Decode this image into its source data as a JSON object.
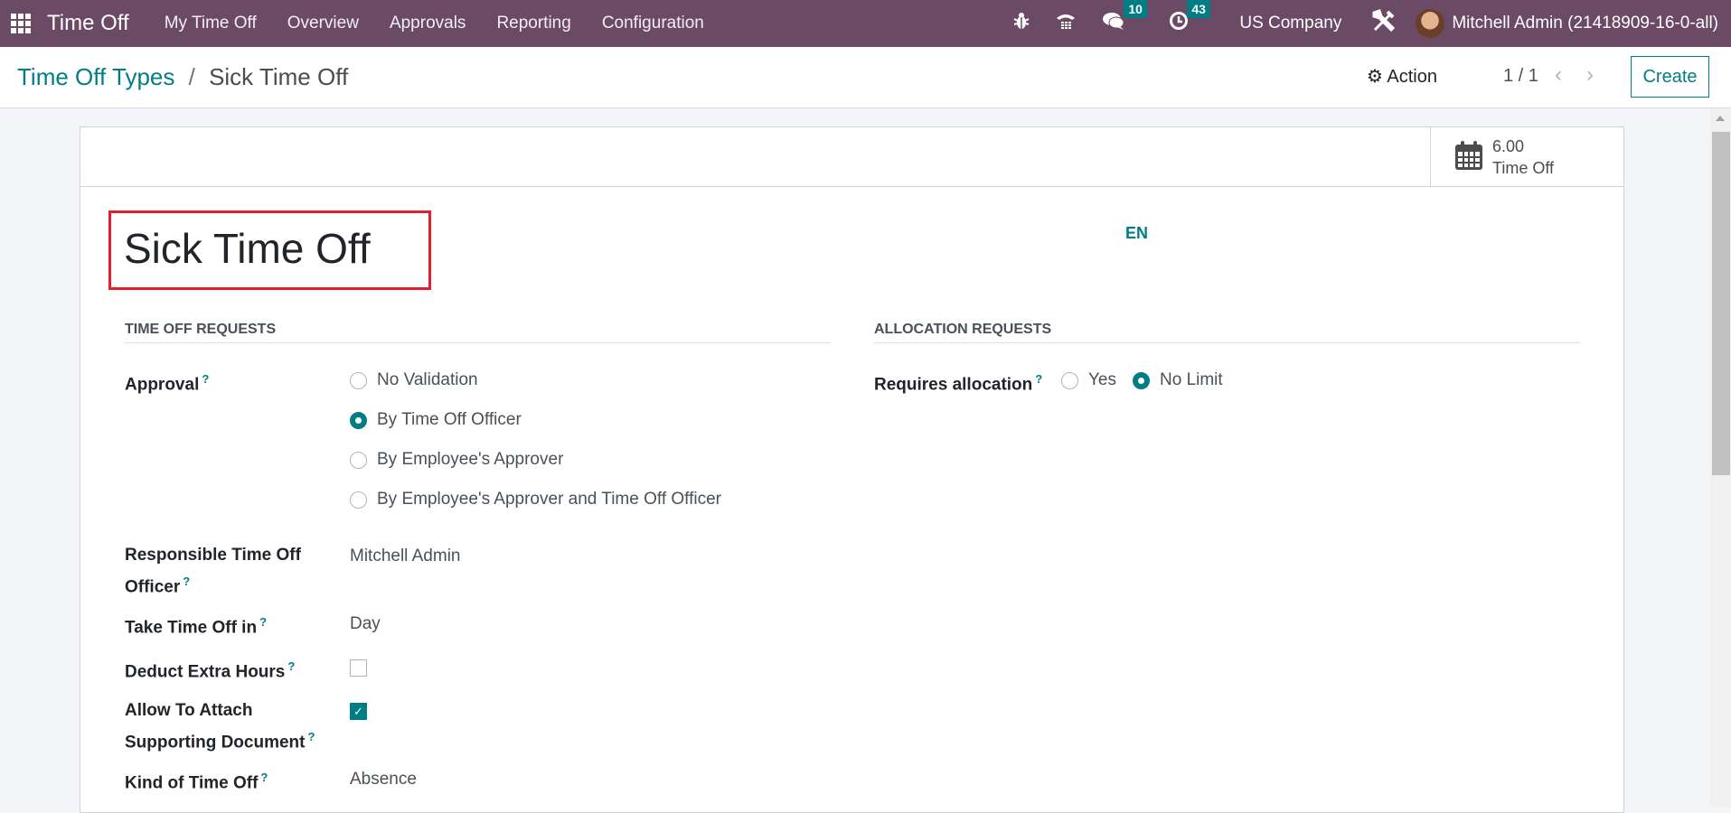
{
  "navbar": {
    "app_name": "Time Off",
    "menu": [
      "My Time Off",
      "Overview",
      "Approvals",
      "Reporting",
      "Configuration"
    ],
    "icons": [
      "bug-icon",
      "phone-icon",
      "chat-icon",
      "clock-icon",
      "tools-icon"
    ],
    "messages_count": "10",
    "activities_count": "43",
    "company": "US Company",
    "user": "Mitchell Admin (21418909-16-0-all)"
  },
  "control": {
    "breadcrumb_parent": "Time Off Types",
    "breadcrumb_sep": "/",
    "breadcrumb_current": "Sick Time Off",
    "action_label": "Action",
    "pager": "1 / 1",
    "create_label": "Create"
  },
  "stat": {
    "value": "6.00",
    "label": "Time Off"
  },
  "form": {
    "title": "Sick Time Off",
    "lang": "EN",
    "help_mark": "?",
    "time_off_requests": {
      "heading": "TIME OFF REQUESTS",
      "approval_label": "Approval",
      "approval_options": [
        "No Validation",
        "By Time Off Officer",
        "By Employee's Approver",
        "By Employee's Approver and Time Off Officer"
      ],
      "approval_selected": "By Time Off Officer",
      "responsible_label_1": "Responsible Time Off",
      "responsible_label_2": "Officer",
      "responsible_value": "Mitchell Admin",
      "take_in_label": "Take Time Off in",
      "take_in_value": "Day",
      "deduct_label": "Deduct Extra Hours",
      "deduct_checked": false,
      "attach_label_1": "Allow To Attach",
      "attach_label_2": "Supporting Document",
      "attach_checked": true,
      "kind_label": "Kind of Time Off",
      "kind_value": "Absence"
    },
    "allocation_requests": {
      "heading": "ALLOCATION REQUESTS",
      "requires_label": "Requires allocation",
      "options": [
        "Yes",
        "No Limit"
      ],
      "selected": "No Limit"
    }
  }
}
